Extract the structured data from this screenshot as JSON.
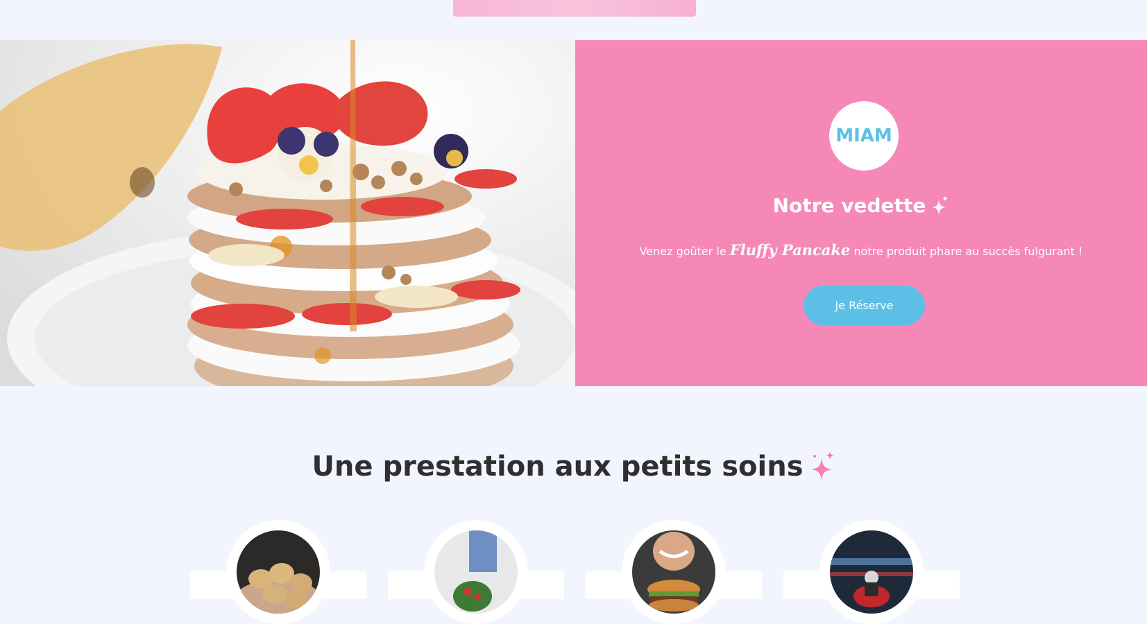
{
  "hero": {
    "badge": "MIAM",
    "title": "Notre vedette",
    "text_before": "Venez goûter le",
    "brand": "Fluffy Pancake",
    "text_after": "notre produit phare au succès fulgurant !",
    "cta_label": "Je Réserve"
  },
  "services": {
    "title": "Une prestation aux petits soins",
    "cards": [
      {
        "image": "potatoes-photo"
      },
      {
        "image": "salad-photo"
      },
      {
        "image": "burger-photo"
      },
      {
        "image": "delivery-scooter-photo"
      }
    ]
  },
  "colors": {
    "background": "#f3f5fe",
    "pink": "#f588b7",
    "blue": "#5cbfe6",
    "heading": "#2f2f2f"
  }
}
